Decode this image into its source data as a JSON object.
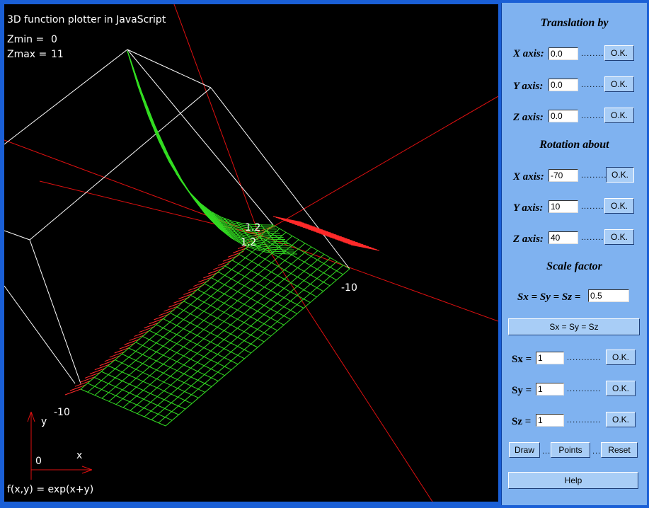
{
  "plot": {
    "title": "3D function plotter in JavaScript",
    "zmin_label": "Zmin =",
    "zmin_value": "0",
    "zmax_label": "Zmax =",
    "zmax_value": "11",
    "function_label": "f(x,y) = exp(x+y)",
    "axis_y": "y",
    "axis_x": "x",
    "origin": "0",
    "ticks": {
      "neg_y": "-10",
      "neg_x": "-10",
      "max_a": "1.2",
      "max_b": "1.2"
    },
    "colors": {
      "background": "#000000",
      "surface": "#33dd22",
      "axes": "#e01010",
      "box": "#ffffff",
      "shadow_lines": "#ff2a2a"
    }
  },
  "panel": {
    "translation": {
      "heading": "Translation by",
      "x_label": "X axis:",
      "x_value": "0.0",
      "y_label": "Y axis:",
      "y_value": "0.0",
      "z_label": "Z axis:",
      "z_value": "0.0"
    },
    "rotation": {
      "heading": "Rotation about",
      "x_label": "X axis:",
      "x_value": "-70",
      "y_label": "Y axis:",
      "y_value": "10",
      "z_label": "Z axis:",
      "z_value": "40"
    },
    "scale": {
      "heading": "Scale factor",
      "uniform_label": "Sx = Sy = Sz =",
      "uniform_value": "0.5",
      "uniform_button": "Sx = Sy = Sz",
      "sx_label": "Sx =",
      "sx_value": "1",
      "sy_label": "Sy =",
      "sy_value": "1",
      "sz_label": "Sz =",
      "sz_value": "1"
    },
    "ok_label": "O.K.",
    "dots": "............",
    "draw_label": "Draw",
    "points_label": "Points",
    "reset_label": "Reset",
    "sep": "...",
    "help_label": "Help"
  }
}
